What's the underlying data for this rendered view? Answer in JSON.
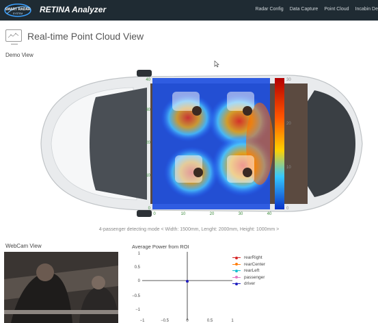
{
  "app": {
    "brand_top": "SMART RADAR",
    "brand_bottom": "SYSTEM",
    "product": "RETINA Analyzer",
    "nav": [
      "Radar Config",
      "Data Capture",
      "Point Cloud",
      "Incabin De"
    ]
  },
  "page": {
    "title": "Real-time Point Cloud View"
  },
  "demo": {
    "label": "Demo View",
    "caption": "4-passenger detecting mode < Width: 1500mm, Lenght: 2000mm, Height: 1000mm >",
    "x_ticks": [
      "0",
      "10",
      "20",
      "30",
      "40"
    ],
    "y_ticks": [
      "0",
      "10",
      "20",
      "30",
      "40"
    ],
    "colorbar_ticks": [
      "30",
      "20",
      "10",
      "0"
    ]
  },
  "webcam": {
    "label": "WebCam View"
  },
  "power_chart": {
    "title": "Average Power from ROI",
    "legend_colors": [
      "#d62728",
      "#ff7f0e",
      "#17becf",
      "#e377c2",
      "#1f1fbf"
    ]
  },
  "chart_data": {
    "type": "scatter",
    "title": "Average Power from ROI",
    "xlim": [
      -1,
      1
    ],
    "ylim": [
      -1,
      1
    ],
    "x_ticks": [
      "−1",
      "−0.5",
      "0",
      "0.5",
      "1"
    ],
    "y_ticks": [
      "1",
      "0.5",
      "0",
      "−0.5",
      "−1"
    ],
    "series": [
      {
        "name": "rearRight",
        "x": [
          0
        ],
        "y": [
          0
        ]
      },
      {
        "name": "rearCenter",
        "x": [
          0
        ],
        "y": [
          0
        ]
      },
      {
        "name": "rearLeft",
        "x": [
          0
        ],
        "y": [
          0
        ]
      },
      {
        "name": "passenger",
        "x": [
          0
        ],
        "y": [
          0
        ]
      },
      {
        "name": "driver",
        "x": [
          0
        ],
        "y": [
          0
        ]
      }
    ],
    "grid": false,
    "legend": "right"
  }
}
